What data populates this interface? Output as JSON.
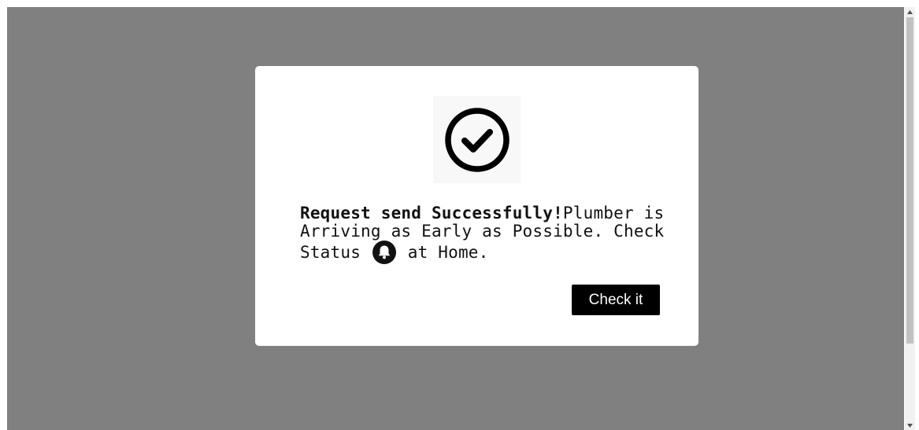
{
  "modal": {
    "message": {
      "bold": "Request send Successfully!",
      "text1": "Plumber is Arriving as Early as Possible. Check Status",
      "text2": "at Home."
    },
    "button_label": "Check it"
  },
  "icons": {
    "success": "check-circle-icon",
    "status": "bell-icon"
  },
  "colors": {
    "overlay": "#808080",
    "modal_bg": "#ffffff",
    "button_bg": "#000000",
    "button_text": "#ffffff",
    "text": "#111111"
  }
}
